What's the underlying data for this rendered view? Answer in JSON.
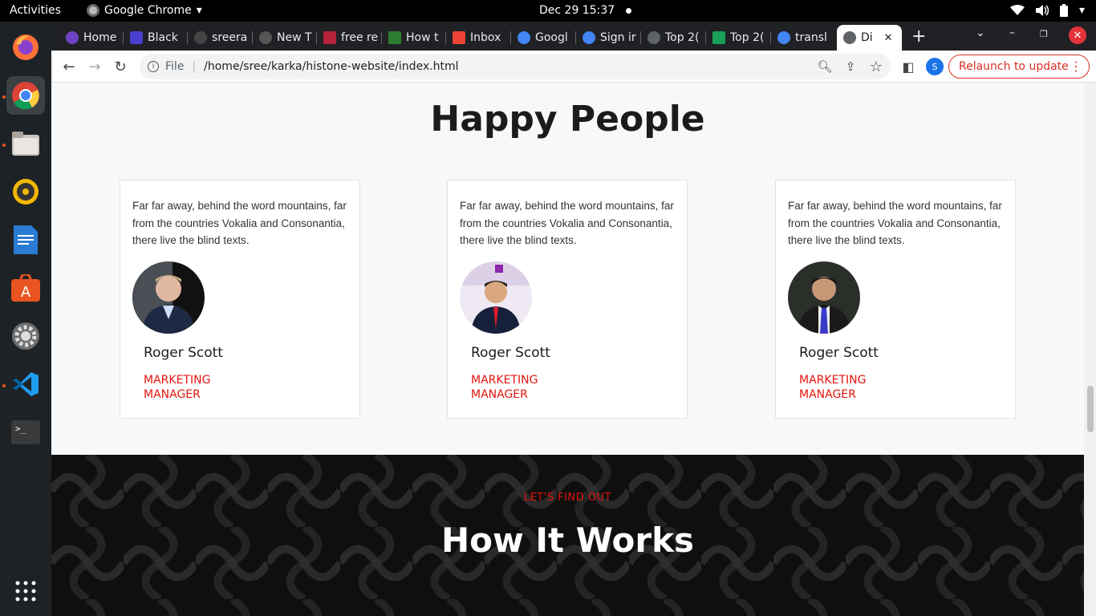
{
  "system": {
    "activities": "Activities",
    "app_name": "Google Chrome",
    "clock": "Dec 29  15:37"
  },
  "tabs": [
    {
      "label": "Home",
      "color": "#6f42c1"
    },
    {
      "label": "Black",
      "color": "#4b3fd1"
    },
    {
      "label": "sreera",
      "color": "#444"
    },
    {
      "label": "New T",
      "color": "#555"
    },
    {
      "label": "free re",
      "color": "#b4233a"
    },
    {
      "label": "How t",
      "color": "#2e7d32"
    },
    {
      "label": "Inbox",
      "color": "#ea4335"
    },
    {
      "label": "Googl",
      "color": "#4285f4"
    },
    {
      "label": "Sign ir",
      "color": "#4285f4"
    },
    {
      "label": "Top 2(",
      "color": "#5f6368"
    },
    {
      "label": "Top 2(",
      "color": "#18a058"
    },
    {
      "label": "transl",
      "color": "#4285f4"
    },
    {
      "label": "Di",
      "color": "#5f6368",
      "active": true
    }
  ],
  "toolbar": {
    "scheme_label": "File",
    "url": "/home/sree/karka/histone-website/index.html",
    "profile_initial": "S",
    "relaunch_label": "Relaunch to update"
  },
  "page": {
    "section_title": "Happy People",
    "testimonials": [
      {
        "quote": "Far far away, behind the word mountains, far from the countries Vokalia and Consonantia, there live the blind texts.",
        "name": "Roger Scott",
        "role": "Marketing Manager"
      },
      {
        "quote": "Far far away, behind the word mountains, far from the countries Vokalia and Consonantia, there live the blind texts.",
        "name": "Roger Scott",
        "role": "Marketing Manager"
      },
      {
        "quote": "Far far away, behind the word mountains, far from the countries Vokalia and Consonantia, there live the blind texts.",
        "name": "Roger Scott",
        "role": "Marketing Manager"
      }
    ],
    "how_it_works": {
      "eyebrow": "LET'S FIND OUT",
      "heading": "How It Works"
    }
  },
  "colors": {
    "accent": "#e3140d",
    "dark_section": "#0f0f0f",
    "page_bg": "#f7f8fa"
  },
  "dock_icons": [
    "firefox-icon",
    "chrome-icon",
    "files-icon",
    "rhythmbox-icon",
    "writer-icon",
    "software-icon",
    "settings-icon",
    "vscode-icon",
    "terminal-icon",
    "app-grid-icon"
  ]
}
